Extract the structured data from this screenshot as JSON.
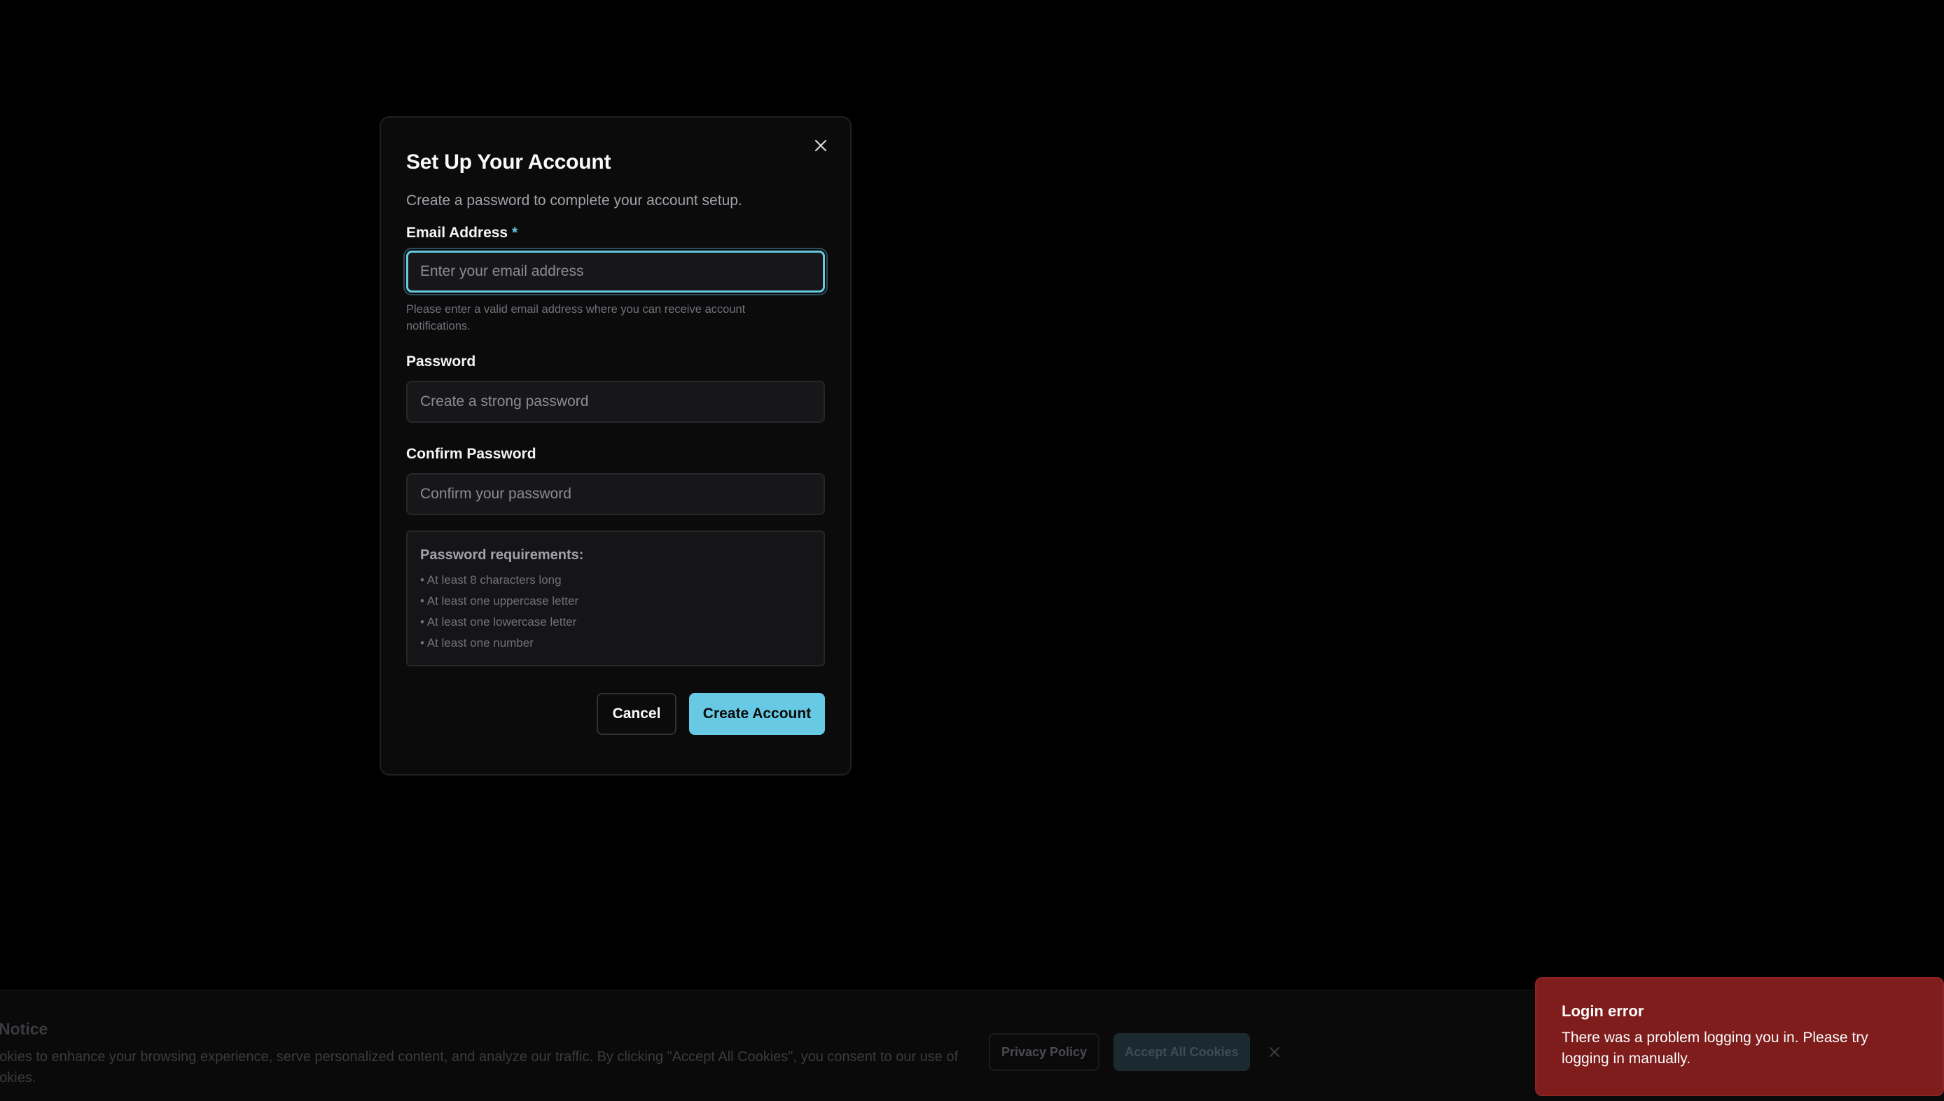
{
  "modal": {
    "title": "Set Up Your Account",
    "description": "Create a password to complete your account setup.",
    "close_icon": "close-icon",
    "email": {
      "label": "Email Address",
      "required_marker": "*",
      "placeholder": "Enter your email address",
      "value": "",
      "hint": "Please enter a valid email address where you can receive account notifications."
    },
    "password": {
      "label": "Password",
      "placeholder": "Create a strong password",
      "value": ""
    },
    "confirm_password": {
      "label": "Confirm Password",
      "placeholder": "Confirm your password",
      "value": ""
    },
    "requirements": {
      "title": "Password requirements:",
      "items": [
        "• At least 8 characters long",
        "• At least one uppercase letter",
        "• At least one lowercase letter",
        "• At least one number"
      ]
    },
    "buttons": {
      "cancel": "Cancel",
      "create": "Create Account"
    }
  },
  "cookie_banner": {
    "title": "Notice",
    "text": "cookies to enhance your browsing experience, serve personalized content, and analyze our traffic. By clicking \"Accept All Cookies\", you consent to our use of cookies.",
    "privacy_button": "Privacy Policy",
    "accept_button": "Accept All Cookies",
    "close_icon": "close-icon"
  },
  "toast": {
    "title": "Login error",
    "message": "There was a problem logging you in. Please try logging in manually."
  },
  "colors": {
    "background": "#000000",
    "accent": "#67c9e3",
    "error": "#7f1d1d"
  }
}
